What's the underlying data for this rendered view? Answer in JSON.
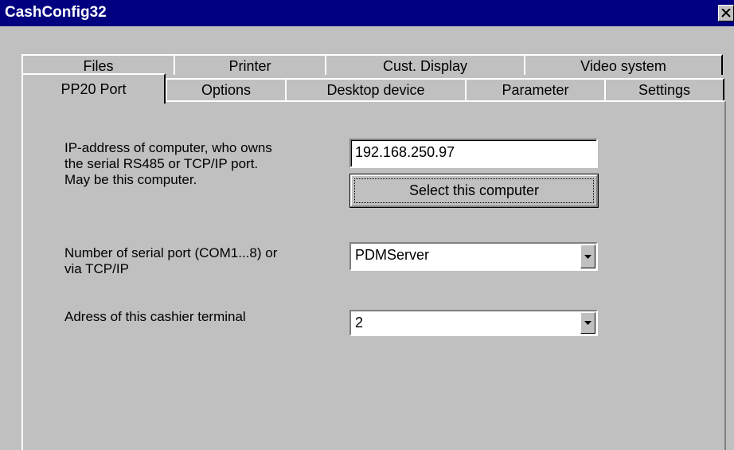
{
  "window": {
    "title": "CashConfig32"
  },
  "tabs": {
    "back_row": [
      "Files",
      "Printer",
      "Cust. Display",
      "Video system"
    ],
    "front_row": [
      "PP20 Port",
      "Options",
      "Desktop device",
      "Parameter",
      "Settings"
    ],
    "active": "PP20 Port"
  },
  "pp20_port": {
    "ip_label": "IP-address of computer, who owns\nthe serial RS485 or TCP/IP port.\nMay be this computer.",
    "ip_value": "192.168.250.97",
    "select_button": "Select this computer",
    "port_label": "Number of serial port (COM1...8) or\nvia TCP/IP",
    "port_value": "PDMServer",
    "address_label": "Adress of this cashier terminal",
    "address_value": "2"
  },
  "icons": {
    "close": "close-icon",
    "dropdown": "chevron-down-icon"
  }
}
